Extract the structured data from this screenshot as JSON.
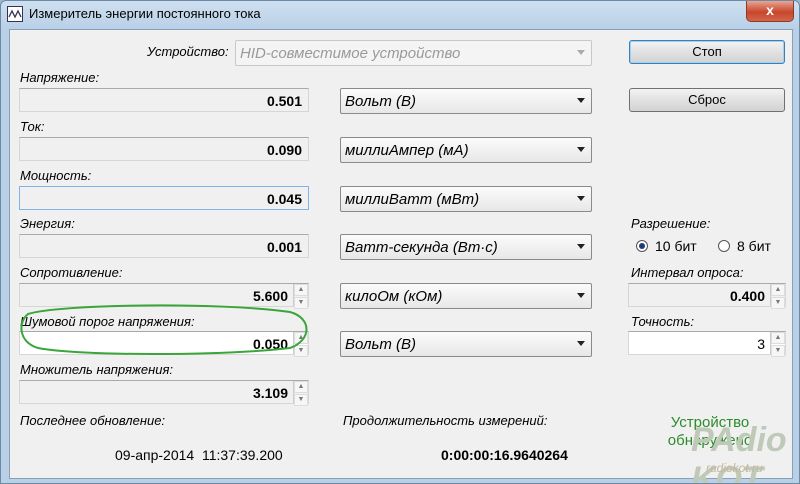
{
  "window": {
    "title": "Измеритель энергии постоянного тока",
    "close_label": "x"
  },
  "device": {
    "label": "Устройство:",
    "value": "HID-совместимое устройство"
  },
  "buttons": {
    "stop": "Стоп",
    "reset": "Сброс"
  },
  "measurements": [
    {
      "label": "Напряжение:",
      "value": "0.501",
      "unit": "Вольт (В)"
    },
    {
      "label": "Ток:",
      "value": "0.090",
      "unit": "миллиАмпер (мА)"
    },
    {
      "label": "Мощность:",
      "value": "0.045",
      "unit": "миллиВатт (мВт)"
    },
    {
      "label": "Энергия:",
      "value": "0.001",
      "unit": "Ватт-секунда (Вт·с)"
    },
    {
      "label": "Сопротивление:",
      "value": "5.600",
      "unit": "килоОм (кОм)"
    },
    {
      "label": "Шумовой порог напряжения:",
      "value": "0.050",
      "unit": "Вольт (В)"
    },
    {
      "label": "Множитель напряжения:",
      "value": "3.109"
    }
  ],
  "resolution": {
    "label": "Разрешение:",
    "options": [
      "10 бит",
      "8 бит"
    ],
    "selected": "10 бит"
  },
  "poll_interval": {
    "label": "Интервал опроса:",
    "value": "0.400"
  },
  "precision": {
    "label": "Точность:",
    "value": "3"
  },
  "last_update": {
    "label": "Последнее обновление:",
    "value": "09-апр-2014  11:37:39.200"
  },
  "duration": {
    "label": "Продолжительность измерений:",
    "value": "0:00:00:16.9640264"
  },
  "status": {
    "line1": "Устройство",
    "line2": "обнаружено"
  },
  "watermark": {
    "logo": "PAdio KOT",
    "site": "radiokot.ru"
  },
  "colors": {
    "status_green": "#2c8c2c",
    "annotation_green": "#3aa53a"
  }
}
